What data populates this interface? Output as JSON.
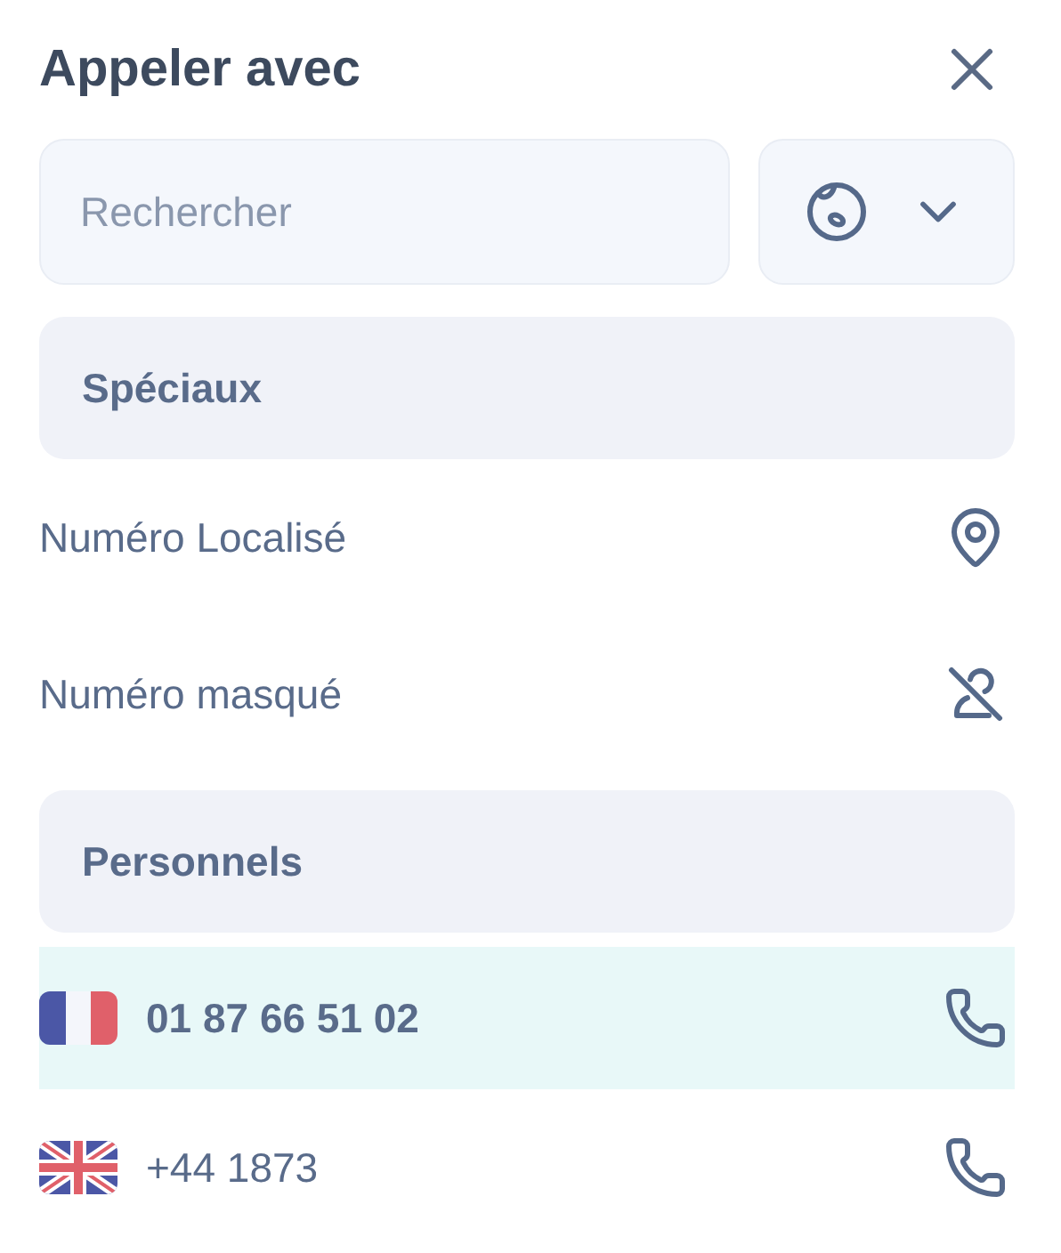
{
  "title": "Appeler avec",
  "search": {
    "placeholder": "Rechercher"
  },
  "sections": [
    {
      "title": "Spéciaux",
      "items": [
        {
          "label": "Numéro Localisé",
          "kind": "localized",
          "selected": false
        },
        {
          "label": "Numéro masqué",
          "kind": "hidden",
          "selected": false
        }
      ]
    },
    {
      "title": "Personnels",
      "items": [
        {
          "label": "01 87 66 51 02",
          "kind": "french",
          "selected": true
        },
        {
          "label": "+44 1873",
          "kind": "british",
          "selected": false
        }
      ]
    }
  ]
}
